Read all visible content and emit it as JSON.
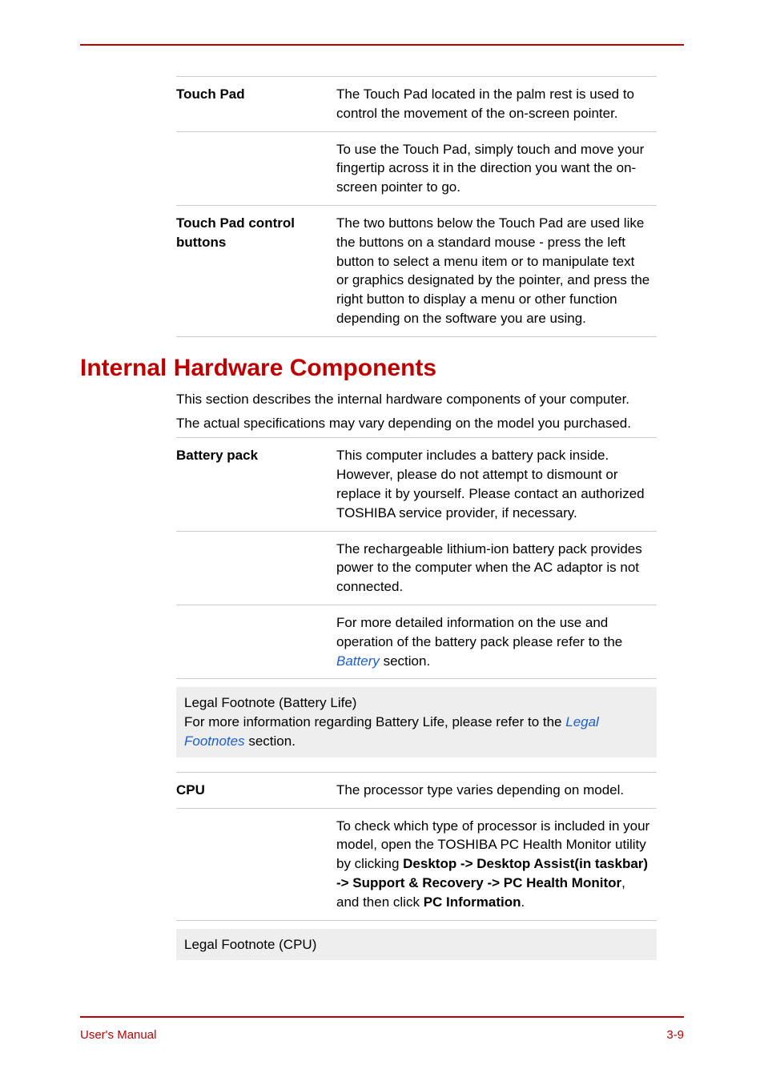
{
  "table1": {
    "rows": [
      {
        "label": "Touch Pad",
        "paras": [
          "The Touch Pad located in the palm rest is used to control the movement of the on-screen pointer.",
          "To use the Touch Pad, simply touch and move your fingertip across it in the direction you want the on-screen pointer to go."
        ]
      },
      {
        "label": "Touch Pad control buttons",
        "paras": [
          "The two buttons below the Touch Pad are used like the buttons on a standard mouse - press the left button to select a menu item or to manipulate text or graphics designated by the pointer, and press the right button to display a menu or other function depending on the software you are using."
        ]
      }
    ]
  },
  "heading": "Internal Hardware Components",
  "intro1": "This section describes the internal hardware components of your computer.",
  "intro2": "The actual specifications may vary depending on the model you purchased.",
  "table2": {
    "battery": {
      "label": "Battery pack",
      "p1": "This computer includes a battery pack inside. However, please do not attempt to dismount or replace it by yourself. Please contact an authorized TOSHIBA service provider, if necessary.",
      "p2": "The rechargeable lithium-ion battery pack provides power to the computer when the AC adaptor is not connected.",
      "p3a": "For more detailed information on the use and operation of the battery pack please refer to the ",
      "p3link": "Battery",
      "p3b": " section."
    }
  },
  "note1": {
    "title": "Legal Footnote (Battery Life)",
    "textA": "For more information regarding Battery Life, please refer to the ",
    "link": "Legal Footnotes",
    "textB": " section."
  },
  "table3": {
    "cpu": {
      "label": "CPU",
      "p1": "The processor type varies depending on model.",
      "p2a": "To check which type of processor is included in your model, open the TOSHIBA PC Health Monitor utility by clicking ",
      "b1": "Desktop -> Desktop Assist(in taskbar) -> Support & Recovery -> PC Health Monitor",
      "p2b": ", and then click ",
      "b2": "PC Information",
      "p2c": "."
    }
  },
  "note2": {
    "title": "Legal Footnote (CPU)"
  },
  "footer": {
    "left": "User's Manual",
    "right": "3-9"
  }
}
